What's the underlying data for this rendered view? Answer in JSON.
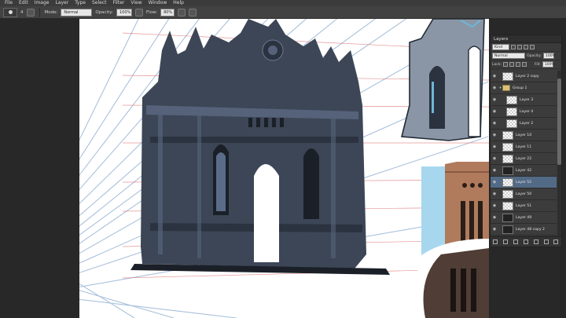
{
  "menu": [
    "File",
    "Edit",
    "Image",
    "Layer",
    "Type",
    "Select",
    "Filter",
    "View",
    "Window",
    "Help"
  ],
  "options": {
    "brush_size": "4",
    "mode_label": "Mode:",
    "mode_value": "Normal",
    "opacity_label": "Opacity:",
    "opacity_value": "100%",
    "flow_label": "Flow:",
    "flow_value": "80%"
  },
  "layers_panel": {
    "title": "Layers",
    "filter_kind": "Kind",
    "blend_mode": "Normal",
    "opacity_label": "Opacity:",
    "opacity_value": "100%",
    "lock_label": "Lock:",
    "fill_label": "Fill:",
    "fill_value": "100%",
    "layers": [
      {
        "name": "Layer 2 copy",
        "indent": false,
        "type": "layer"
      },
      {
        "name": "Group 1",
        "indent": false,
        "type": "group"
      },
      {
        "name": "Layer 3",
        "indent": true,
        "type": "layer"
      },
      {
        "name": "Layer 4",
        "indent": true,
        "type": "layer"
      },
      {
        "name": "Layer 2",
        "indent": true,
        "type": "layer"
      },
      {
        "name": "Layer 10",
        "indent": false,
        "type": "layer"
      },
      {
        "name": "Layer 11",
        "indent": false,
        "type": "layer"
      },
      {
        "name": "Layer 22",
        "indent": false,
        "type": "layer"
      },
      {
        "name": "Layer 42",
        "indent": false,
        "type": "dark"
      },
      {
        "name": "Layer 52",
        "indent": false,
        "type": "layer",
        "selected": true
      },
      {
        "name": "Layer 50",
        "indent": false,
        "type": "layer"
      },
      {
        "name": "Layer 51",
        "indent": false,
        "type": "layer"
      },
      {
        "name": "Layer 49",
        "indent": false,
        "type": "dark"
      },
      {
        "name": "Layer 48 copy 2",
        "indent": false,
        "type": "dark"
      }
    ]
  },
  "colors": {
    "accent_selected": "#526a86",
    "perspective_blue": "#9bb7d6",
    "perspective_red": "#e07a7a"
  }
}
